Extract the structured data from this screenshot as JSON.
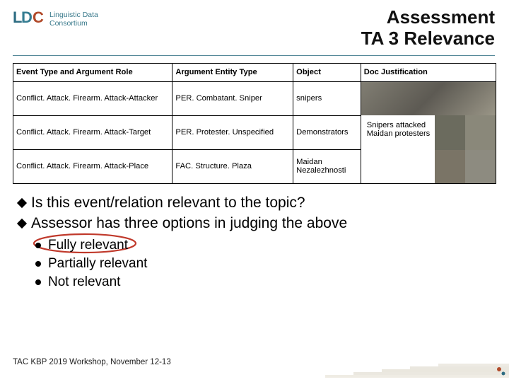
{
  "logo": {
    "line1": "Linguistic Data",
    "line2": "Consortium"
  },
  "title_line1": "Assessment",
  "title_line2": "TA 3 Relevance",
  "table": {
    "headers": [
      "Event Type and Argument Role",
      "Argument Entity Type",
      "Object",
      "Doc Justification"
    ],
    "rows": [
      {
        "event": "Conflict. Attack. Firearm. Attack-Attacker",
        "entity": "PER. Combatant. Sniper",
        "object": "snipers",
        "doc_text": ""
      },
      {
        "event": "Conflict. Attack. Firearm. Attack-Target",
        "entity": "PER. Protester. Unspecified",
        "object": "Demonstrators",
        "doc_text": "Snipers attacked Maidan protesters"
      },
      {
        "event": "Conflict. Attack. Firearm. Attack-Place",
        "entity": "FAC. Structure. Plaza",
        "object": "Maidan Nezalezhnosti",
        "doc_text": ""
      }
    ]
  },
  "bullets": {
    "b1": "Is this event/relation relevant to the topic?",
    "b2": "Assessor has three options in judging the above",
    "sub1": "Fully relevant",
    "sub2": "Partially relevant",
    "sub3": "Not relevant"
  },
  "footer": "TAC KBP 2019 Workshop, November 12-13"
}
